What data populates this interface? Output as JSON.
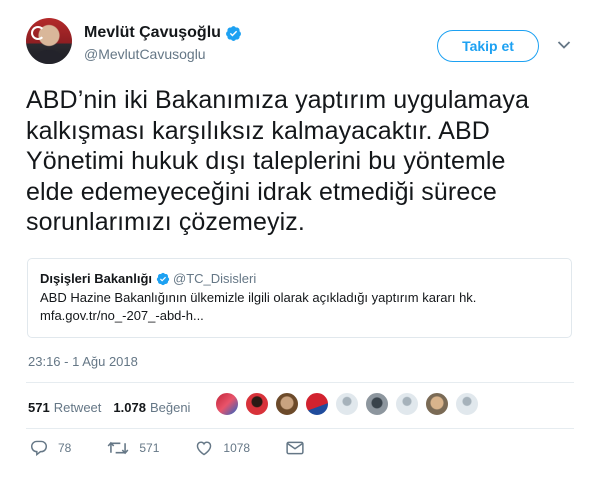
{
  "tweet": {
    "display_name": "Mevlüt Çavuşoğlu",
    "handle": "@MevlutCavusoglu",
    "follow_label": "Takip et",
    "text_lines": [
      "ABD’nin iki Bakanımıza yaptırım uygulamaya",
      "kalkışması karşılıksız kalmayacaktır. ABD",
      "Yönetimi hukuk dışı taleplerini bu yöntemle",
      "elde edemeyeceğini idrak etmediği sürece",
      "sorunlarımızı çözemeyiz."
    ],
    "timestamp": "23:16 - 1 Ağu 2018"
  },
  "quote": {
    "name": "Dışişleri Bakanlığı",
    "handle": "@TC_Disisleri",
    "line": "ABD Hazine Bakanlığının ülkemizle ilgili olarak açıkladığı yaptırım kararı hk.",
    "link": "mfa.gov.tr/no_-207_-abd-h..."
  },
  "stats": {
    "retweet_count": "571",
    "retweet_label": "Retweet",
    "like_count": "1.078",
    "like_label": "Beğeni"
  },
  "actions": {
    "reply_count": "78",
    "retweet_count": "571",
    "like_count": "1078"
  },
  "icons": {
    "verified": "verified-badge-icon",
    "caret": "chevron-down-icon",
    "reply": "reply-icon",
    "retweet": "retweet-icon",
    "like": "heart-icon",
    "dm": "envelope-icon"
  },
  "colors": {
    "accent": "#1da1f2",
    "text": "#14171a",
    "secondary": "#657786",
    "border": "#e1e8ed"
  }
}
